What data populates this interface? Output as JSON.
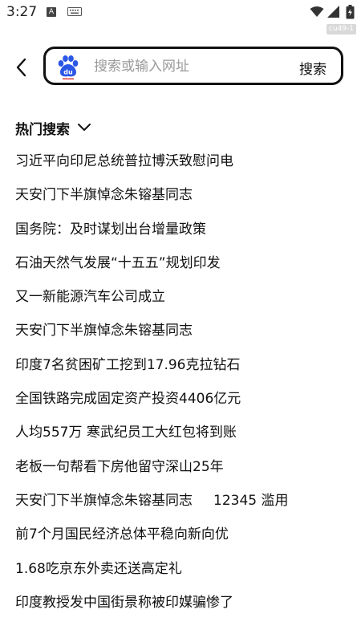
{
  "status": {
    "time": "3:27",
    "notification_letter": "A",
    "badge": "cu49-1"
  },
  "search": {
    "placeholder": "搜索或输入网址",
    "button_label": "搜索"
  },
  "hot": {
    "title": "热门搜索",
    "items": [
      {
        "text": "习近平向印尼总统普拉博沃致慰问电",
        "extra": ""
      },
      {
        "text": "天安门下半旗悼念朱镕基同志",
        "extra": ""
      },
      {
        "text": "国务院：及时谋划出台增量政策",
        "extra": ""
      },
      {
        "text": "石油天然气发展“十五五”规划印发",
        "extra": ""
      },
      {
        "text": "又一新能源汽车公司成立",
        "extra": ""
      },
      {
        "text": "天安门下半旗悼念朱镕基同志",
        "extra": ""
      },
      {
        "text": "印度7名贫困矿工挖到17.96克拉钻石",
        "extra": ""
      },
      {
        "text": "全国铁路完成固定资产投资4406亿元",
        "extra": ""
      },
      {
        "text": "人均557万 寒武纪员工大红包将到账",
        "extra": ""
      },
      {
        "text": "老板一句帮看下房他留守深山25年",
        "extra": ""
      },
      {
        "text": "天安门下半旗悼念朱镕基同志",
        "extra": "12345 滥用"
      },
      {
        "text": "前7个月国民经济总体平稳向新向优",
        "extra": ""
      },
      {
        "text": "1.68吃京东外卖还送高定礼",
        "extra": ""
      },
      {
        "text": "印度教授发中国街景称被印媒骗惨了",
        "extra": ""
      }
    ]
  }
}
